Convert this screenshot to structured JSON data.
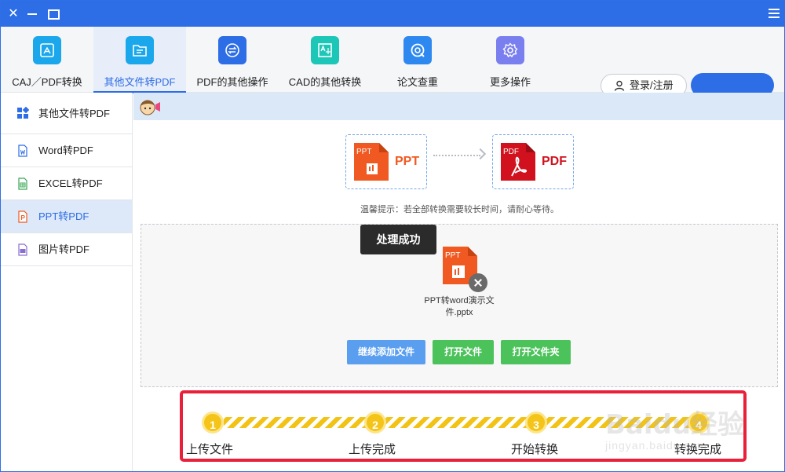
{
  "colors": {
    "accent": "#2d6de6",
    "success": "#4cc25b",
    "highlight": "#e8203a",
    "step": "#f5c418",
    "ppt": "#f05a22",
    "pdf": "#d1121e"
  },
  "titlebar": {
    "close_icon": "close-icon",
    "min_icon": "minimize-icon",
    "max_icon": "maximize-icon",
    "menu_icon": "menu-icon"
  },
  "nav": {
    "items": [
      {
        "label": "CAJ／PDF转换",
        "icon": "caj-pdf-icon",
        "color": "#1aa7ec"
      },
      {
        "label": "其他文件转PDF",
        "icon": "file-to-pdf-icon",
        "color": "#1aa7ec",
        "active": true
      },
      {
        "label": "PDF的其他操作",
        "icon": "pdf-ops-icon",
        "color": "#2d6de6"
      },
      {
        "label": "CAD的其他转换",
        "icon": "cad-icon",
        "color": "#1cc7b8"
      },
      {
        "label": "论文查重",
        "icon": "paper-check-icon",
        "color": "#2d88f0"
      },
      {
        "label": "更多操作",
        "icon": "gear-icon",
        "color": "#7a7ff0"
      }
    ],
    "login_label": "登录/注册"
  },
  "sidebar": {
    "items": [
      {
        "label": "其他文件转PDF",
        "icon": "grid-icon"
      },
      {
        "label": "Word转PDF",
        "icon": "word-file-icon"
      },
      {
        "label": "EXCEL转PDF",
        "icon": "excel-file-icon"
      },
      {
        "label": "PPT转PDF",
        "icon": "ppt-file-icon",
        "active": true
      },
      {
        "label": "图片转PDF",
        "icon": "image-file-icon"
      }
    ]
  },
  "conversion": {
    "source_format": "PPT",
    "target_format": "PDF",
    "source_doc_tag": "PPT",
    "target_doc_tag": "PDF",
    "hint": "温馨提示：若全部转换需要较长时间，请耐心等待。"
  },
  "file": {
    "toast": "处理成功",
    "doc_tag": "PPT",
    "name_line1": "PPT转word演示文",
    "name_line2": "件.pptx"
  },
  "actions": {
    "add_label": "继续添加文件",
    "open_file_label": "打开文件",
    "open_folder_label": "打开文件夹"
  },
  "steps": [
    {
      "num": "1",
      "label": "上传文件"
    },
    {
      "num": "2",
      "label": "上传完成"
    },
    {
      "num": "3",
      "label": "开始转换"
    },
    {
      "num": "4",
      "label": "转换完成"
    }
  ],
  "watermark": {
    "logo": "Baidu经验",
    "sub": "jingyan.baidu.com"
  }
}
